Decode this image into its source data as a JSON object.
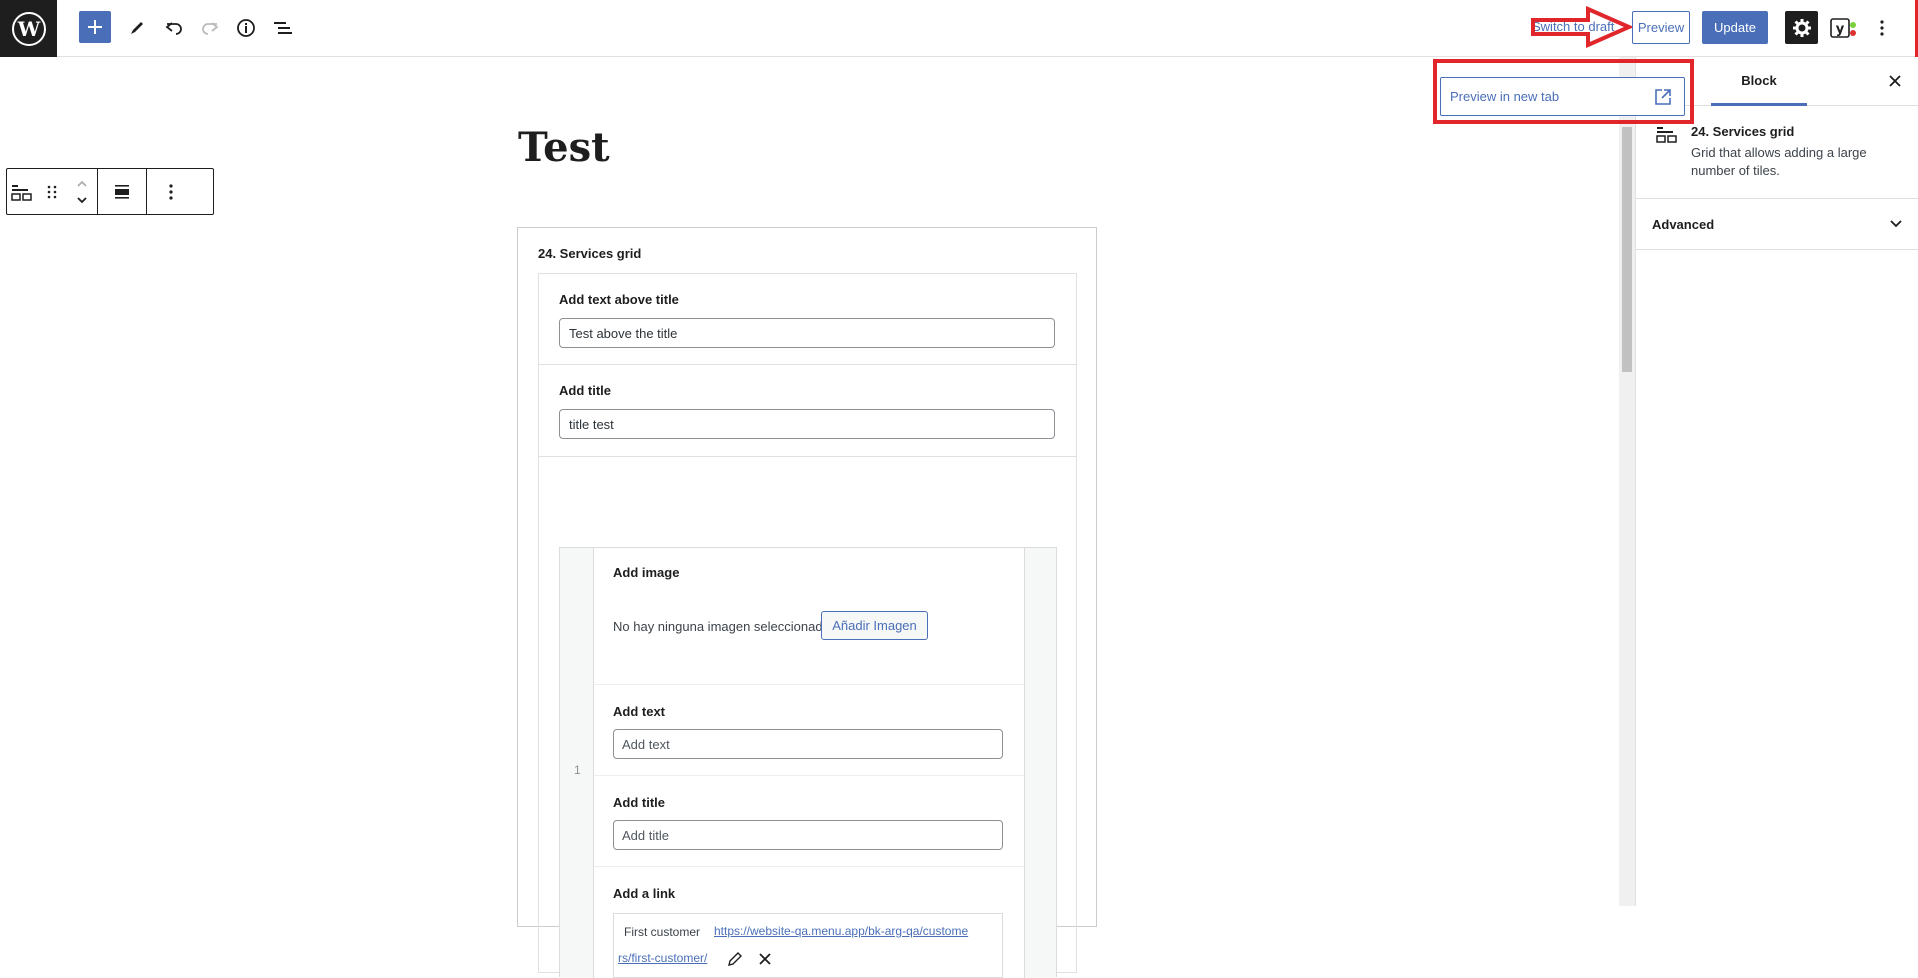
{
  "header": {
    "switch_to_draft": "Switch to draft",
    "preview_label": "Preview",
    "update_label": "Update",
    "yoast_label": "y"
  },
  "preview_dropdown": {
    "item_label": "Preview in new tab"
  },
  "editor": {
    "post_title": "Test",
    "block_title": "24. Services grid",
    "fields": {
      "text_above_title_label": "Add text above title",
      "text_above_title_value": "Test above the title",
      "title_label": "Add title",
      "title_value": "title test"
    },
    "repeater": {
      "row_number": "1",
      "image_label": "Add image",
      "no_image_text": "No hay ninguna imagen seleccionada",
      "add_image_button": "Añadir Imagen",
      "text_label": "Add text",
      "text_placeholder": "Add text",
      "title_label": "Add title",
      "title_placeholder": "Add title",
      "link_label": "Add a link",
      "link_name": "First customer",
      "link_url_part1": "https://website-qa.menu.app/bk-arg-qa/custome",
      "link_url_part2": "rs/first-customer/"
    }
  },
  "sidebar": {
    "tab_block": "Block",
    "block_name": "24. Services grid",
    "block_description": "Grid that allows adding a large number of tiles.",
    "advanced_label": "Advanced"
  },
  "colors": {
    "accent": "#4a6fb8",
    "annotation_red": "#e0262b",
    "dark": "#1e1e1e"
  }
}
